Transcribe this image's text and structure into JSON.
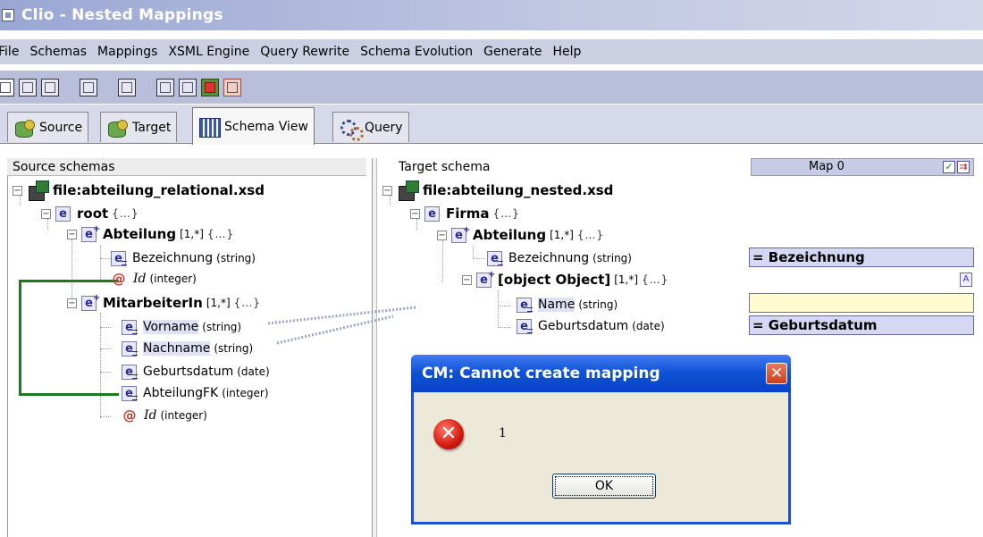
{
  "window": {
    "title": "Clio - Nested Mappings",
    "icon": "app-icon"
  },
  "menu": [
    "File",
    "Schemas",
    "Mappings",
    "XSML Engine",
    "Query Rewrite",
    "Schema Evolution",
    "Generate",
    "Help"
  ],
  "toolbar": {
    "buttons": [
      "new-icon",
      "open-icon",
      "save-icon",
      "mapping-icon",
      "blank-icon",
      "layout-icon",
      "grid-icon",
      "run-icon",
      "transform-icon"
    ]
  },
  "tabs": [
    {
      "label": "Source",
      "icon": "database-icon",
      "active": false
    },
    {
      "label": "Target",
      "icon": "database-icon",
      "active": false
    },
    {
      "label": "Schema View",
      "icon": "grid-icon",
      "active": true
    },
    {
      "label": "Query",
      "icon": "gear-icon",
      "active": false
    }
  ],
  "source": {
    "header": "Source schemas",
    "file": "file:abteilung_relational.xsd",
    "root": {
      "name": "root",
      "ext": "{…}"
    },
    "abteilung": {
      "name": "Abteilung",
      "card": "[1,*]",
      "ext": "{…}",
      "bezeichnung": {
        "name": "Bezeichnung",
        "type": "(string)"
      },
      "id": {
        "name": "Id",
        "type": "(integer)"
      }
    },
    "mitarbeiter": {
      "name": "MitarbeiterIn",
      "card": "[1,*]",
      "ext": "{…}",
      "vorname": {
        "name": "Vorname",
        "type": "(string)"
      },
      "nachname": {
        "name": "Nachname",
        "type": "(string)"
      },
      "geburtsdatum": {
        "name": "Geburtsdatum",
        "type": "(date)"
      },
      "abteilungfk": {
        "name": "AbteilungFK",
        "type": "(integer)"
      },
      "id": {
        "name": "Id",
        "type": "(integer)"
      }
    }
  },
  "target": {
    "header": "Target schema",
    "file": "file:abteilung_nested.xsd",
    "firma": {
      "name": "Firma",
      "ext": "{…}"
    },
    "abteilung": {
      "name": "Abteilung",
      "card": "[1,*]",
      "ext": "{…}",
      "bezeichnung": {
        "name": "Bezeichnung",
        "type": "(string)"
      }
    },
    "mitarbeiter": {
      "name": {
        "name": "Name",
        "type": "(string)"
      },
      "card": "[1,*]",
      "ext": "{…}",
      "geburtsdatum": {
        "name": "Geburtsdatum",
        "type": "(date)"
      }
    }
  },
  "mapping": {
    "header": "Map 0",
    "rows": [
      "= Bezeichnung",
      "",
      "= Geburtsdatum"
    ]
  },
  "dialog": {
    "title": "CM: Cannot create mapping",
    "message": "1",
    "ok": "OK",
    "icon": "error-icon"
  },
  "colors": {
    "title_bar": "#9aa7d3",
    "dialog_title": "#0e50d4",
    "link_line": "#1f7a1f",
    "mapping_row": "#d6d8f3"
  }
}
